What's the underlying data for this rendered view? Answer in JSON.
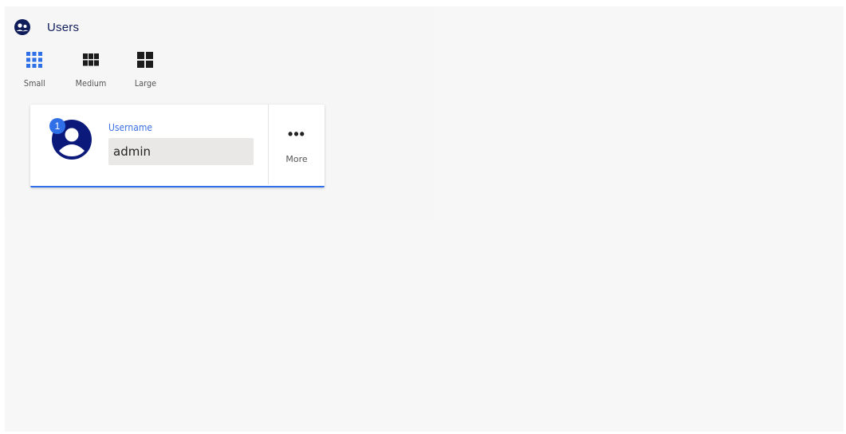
{
  "header": {
    "title": "Users",
    "title_icon": "users-icon"
  },
  "size_options": [
    {
      "label": "Small",
      "icon": "grid-small-icon",
      "active": true
    },
    {
      "label": "Medium",
      "icon": "grid-medium-icon",
      "active": false
    },
    {
      "label": "Large",
      "icon": "grid-large-icon",
      "active": false
    }
  ],
  "user_card": {
    "badge": "1",
    "avatar_icon": "account-circle-icon",
    "field_label": "Username",
    "field_value": "admin",
    "more_label": "More",
    "more_icon": "more-dots-icon"
  },
  "colors": {
    "accent": "#2f6fe8",
    "title_text": "#0f1c5a",
    "avatar": "#0b1a7a"
  }
}
